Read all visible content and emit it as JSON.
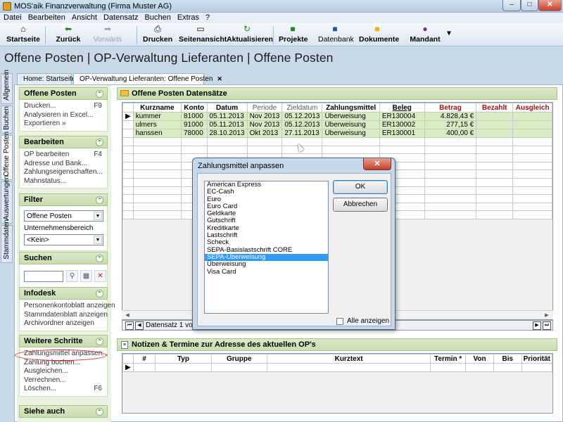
{
  "window": {
    "title": "MOS'aik Finanzverwaltung (Firma Muster AG)",
    "minimize_glyph": "–",
    "maximize_glyph": "□",
    "close_glyph": "✕"
  },
  "menu": [
    "Datei",
    "Bearbeiten",
    "Ansicht",
    "Datensatz",
    "Buchen",
    "Extras",
    "?"
  ],
  "toolbar": {
    "startseite": "Startseite",
    "zurueck": "Zurück",
    "vorwaerts": "Vorwärts",
    "drucken": "Drucken",
    "seitenansicht": "Seitenansicht",
    "aktualisieren": "Aktualisieren",
    "projekte": "Projekte",
    "datenbank": "Datenbank",
    "dokumente": "Dokumente",
    "mandant": "Mandant",
    "dropdown_glyph": "▾"
  },
  "page": {
    "title": "Offene Posten | OP-Verwaltung Lieferanten | Offene Posten"
  },
  "tabs": {
    "home": "Home: Startseite",
    "active": "OP-Verwaltung Lieferanten: Offene Posten",
    "close_glyph": "✕"
  },
  "side_tabs": [
    "Allgemein",
    "Buchen",
    "Offene Posten",
    "Auswertungen",
    "Stammdaten"
  ],
  "left_panel": {
    "offene_posten": {
      "title": "Offene Posten",
      "items": [
        {
          "label": "Drucken...",
          "key": "F9"
        },
        {
          "label": "Analysieren in Excel...",
          "key": ""
        },
        {
          "label": "Exportieren »",
          "key": ""
        }
      ]
    },
    "bearbeiten": {
      "title": "Bearbeiten",
      "items": [
        {
          "label": "OP bearbeiten",
          "key": "F4"
        },
        {
          "label": "Adresse und Bank...",
          "key": ""
        },
        {
          "label": "Zahlungseigenschaften...",
          "key": ""
        },
        {
          "label": "Mahnstatus...",
          "key": ""
        }
      ]
    },
    "filter": {
      "title": "Filter",
      "selected": "Offene Posten",
      "field_label": "Unternehmensbereich",
      "field_value": "<Kein>"
    },
    "suchen": {
      "title": "Suchen"
    },
    "infodesk": {
      "title": "Infodesk",
      "items": [
        "Personenkontoblatt anzeigen",
        "Stammdatenblatt anzeigen",
        "Archivordner anzeigen"
      ]
    },
    "weitere_schritte": {
      "title": "Weitere Schritte",
      "items": [
        {
          "label": "Zahlungsmittel anpassen...",
          "key": ""
        },
        {
          "label": "Zahlung buchen...",
          "key": ""
        },
        {
          "label": "Ausgleichen...",
          "key": ""
        },
        {
          "label": "Verrechnen...",
          "key": ""
        },
        {
          "label": "Löschen...",
          "key": "F6"
        }
      ]
    },
    "siehe_auch": {
      "title": "Siehe auch"
    },
    "chevron_glyph": "⌃"
  },
  "records": {
    "title": "Offene Posten Datensätze",
    "columns": [
      "Kurzname",
      "Konto",
      "Datum",
      "Periode",
      "Zieldatum",
      "Zahlungsmittel",
      "Beleg",
      "Betrag",
      "Bezahlt",
      "Ausgleich"
    ],
    "rows": [
      [
        "kummer",
        "81000",
        "05.11.2013",
        "Nov 2013",
        "05.12.2013",
        "Überweisung",
        "ER130004",
        "4.828,43 €",
        "",
        ""
      ],
      [
        "ulmers",
        "91000",
        "05.11.2013",
        "Nov 2013",
        "05.12.2013",
        "Überweisung",
        "ER130002",
        "277,15 €",
        "",
        ""
      ],
      [
        "hanssen",
        "78000",
        "28.10.2013",
        "Okt 2013",
        "27.11.2013",
        "Überweisung",
        "ER130001",
        "400,00 €",
        "",
        ""
      ]
    ],
    "row_pointer": "▶",
    "nav_label": "Datensatz 1 von 3"
  },
  "notes": {
    "title": "Notizen & Termine zur Adresse des aktuellen OP's",
    "columns": [
      "#",
      "Typ",
      "Gruppe",
      "Kurztext",
      "Termin *",
      "Von",
      "Bis",
      "Priorität"
    ]
  },
  "dialog": {
    "title": "Zahlungsmittel anpassen",
    "close_glyph": "✕",
    "options": [
      "American Express",
      "EC-Cash",
      "Euro",
      "Euro Card",
      "Geldkarte",
      "Gutschrift",
      "Kreditkarte",
      "Lastschrift",
      "Scheck",
      "SEPA-Basislastschrift CORE",
      "SEPA-Überweisung",
      "Überweisung",
      "Visa Card"
    ],
    "selected_index": 10,
    "ok_label": "OK",
    "cancel_label": "Abbrechen",
    "show_all_label": "Alle anzeigen"
  }
}
